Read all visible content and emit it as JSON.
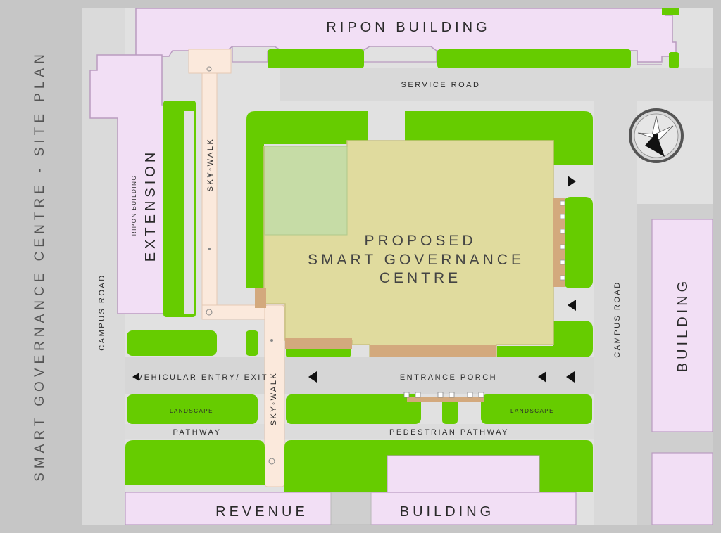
{
  "title": "SMART GOVERNANCE CENTRE - SITE PLAN",
  "buildings": {
    "ripon": "RIPON BUILDING",
    "ripon_ext_small": "RIPON BUILDING",
    "ripon_ext_large": "EXTENSION",
    "proposed_line1": "PROPOSED",
    "proposed_line2": "SMART GOVERNANCE",
    "proposed_line3": "CENTRE",
    "revenue_left": "REVENUE",
    "revenue_right": "BUILDING",
    "right": "BUILDING"
  },
  "roads": {
    "service": "SERVICE ROAD",
    "campus_left": "CAMPUS ROAD",
    "campus_right": "CAMPUS ROAD",
    "vehicular": "VEHICULAR ENTRY/ EXIT",
    "entrance": "ENTRANCE PORCH",
    "pathway": "PATHWAY",
    "pedestrian": "PEDESTRIAN PATHWAY"
  },
  "skywalk": {
    "upper": "SKY◦WALK",
    "lower": "SKY◦WALK"
  },
  "landscape": {
    "left": "LANDSCAPE",
    "right": "LANDSCAPE"
  },
  "north": "N",
  "colors": {
    "background": "#c6c6c6",
    "site": "#e1e1e1",
    "road": "#d4d4d4",
    "building": "#f2dff5",
    "building_outline": "#b99bc0",
    "landscape": "#66cc00",
    "proposed": "#e0db9e",
    "courtyard": "#c6dca6",
    "porch": "#d3a97d",
    "skywalk": "#fbe9dc"
  }
}
